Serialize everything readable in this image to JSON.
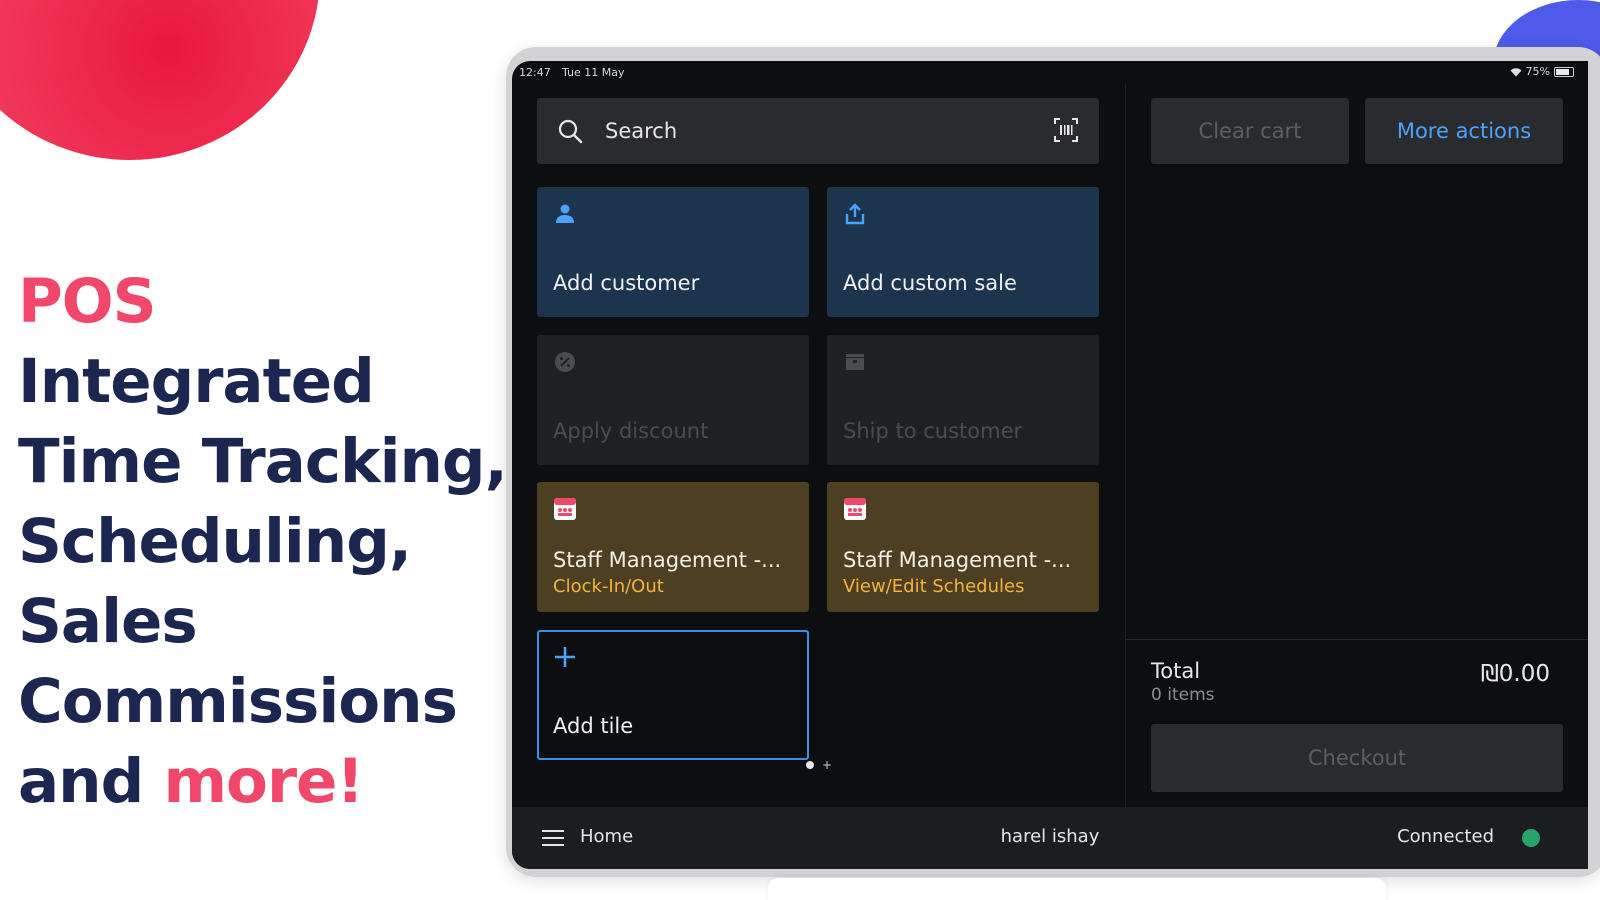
{
  "headline": {
    "accent_1": "POS",
    "line_1_rest": " Integrated",
    "line_2": "Time Tracking,",
    "line_3": "Scheduling,",
    "line_4": "Sales",
    "line_5": "Commissions",
    "line_6_prefix": "and ",
    "accent_2": "more!"
  },
  "status_bar": {
    "time": "12:47",
    "date": "Tue 11 May",
    "battery": "75%"
  },
  "search": {
    "label": "Search"
  },
  "tiles": [
    {
      "label": "Add customer",
      "icon": "person-icon",
      "style": "active"
    },
    {
      "label": "Add custom sale",
      "icon": "upload-icon",
      "style": "active"
    },
    {
      "label": "Apply discount",
      "icon": "discount-icon",
      "style": "disabled"
    },
    {
      "label": "Ship to customer",
      "icon": "box-icon",
      "style": "disabled"
    },
    {
      "label": "Staff Management -...",
      "sublabel": "Clock-In/Out",
      "icon": "staff-app-icon",
      "style": "app"
    },
    {
      "label": "Staff Management -...",
      "sublabel": "View/Edit Schedules",
      "icon": "staff-app-icon",
      "style": "app"
    },
    {
      "label": "Add tile",
      "icon": "plus-icon",
      "style": "add"
    }
  ],
  "cart": {
    "clear_label": "Clear cart",
    "more_label": "More actions",
    "total_label": "Total",
    "items_label": "0 items",
    "total_value": "₪0.00",
    "checkout_label": "Checkout"
  },
  "bottom_bar": {
    "home_label": "Home",
    "user_name": "harel ishay",
    "connection_label": "Connected"
  },
  "colors": {
    "accent_pink": "#f0476b",
    "headline_navy": "#1b2651",
    "link_blue": "#4aa3ff",
    "tile_blue": "#1c344e",
    "tile_gold": "#4c3f22",
    "connected_green": "#27a36b"
  }
}
